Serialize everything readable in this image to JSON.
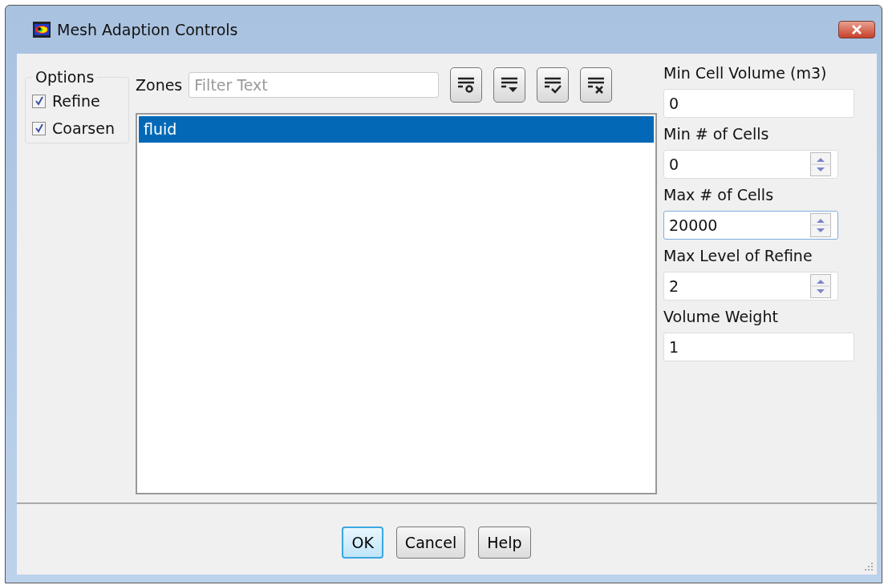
{
  "window": {
    "title": "Mesh Adaption Controls"
  },
  "options": {
    "title": "Options",
    "items": [
      {
        "label": "Refine",
        "checked": true
      },
      {
        "label": "Coarsen",
        "checked": true
      }
    ]
  },
  "zones": {
    "label": "Zones",
    "filter": {
      "placeholder": "Filter Text"
    },
    "items": [
      {
        "label": "fluid",
        "selected": true
      }
    ]
  },
  "fields": [
    {
      "label": "Min Cell Volume (m3)",
      "value": "0",
      "kind": "text",
      "focused": false
    },
    {
      "label": "Min # of Cells",
      "value": "0",
      "kind": "spin",
      "focused": false
    },
    {
      "label": "Max # of Cells",
      "value": "20000",
      "kind": "spin",
      "focused": true
    },
    {
      "label": "Max Level of Refine",
      "value": "2",
      "kind": "spin",
      "focused": false
    },
    {
      "label": "Volume Weight",
      "value": "1",
      "kind": "text",
      "focused": false
    }
  ],
  "buttons": [
    {
      "label": "OK",
      "default": true
    },
    {
      "label": "Cancel",
      "default": false
    },
    {
      "label": "Help",
      "default": false
    }
  ]
}
